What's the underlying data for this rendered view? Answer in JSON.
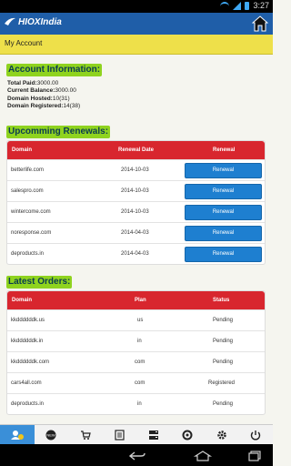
{
  "status_bar": {
    "left": "",
    "time": "3:27"
  },
  "app": {
    "brand": "HIOXIndia"
  },
  "subheader": {
    "title": "My Account"
  },
  "account": {
    "title": "Account Information:",
    "rows": [
      {
        "label": "Total Paid:",
        "value": "3000.00"
      },
      {
        "label": "Current Balance:",
        "value": "3000.00"
      },
      {
        "label": "Domain Hosted:",
        "value": "10(31)"
      },
      {
        "label": "Domain Registered:",
        "value": "14(38)"
      }
    ]
  },
  "renewals": {
    "title": "Upcomming Renewals:",
    "columns": [
      "Domain",
      "Renewal Date",
      "Renewal"
    ],
    "rows": [
      {
        "domain": "betterlife.com",
        "date": "2014-10-03",
        "action": "Renewal"
      },
      {
        "domain": "salespro.com",
        "date": "2014-10-03",
        "action": "Renewal"
      },
      {
        "domain": "wintercome.com",
        "date": "2014-10-03",
        "action": "Renewal"
      },
      {
        "domain": "noresponse.com",
        "date": "2014-04-03",
        "action": "Renewal"
      },
      {
        "domain": "deproducts.in",
        "date": "2014-04-03",
        "action": "Renewal"
      }
    ]
  },
  "orders": {
    "title": "Latest Orders:",
    "columns": [
      "Domain",
      "Plan",
      "Status"
    ],
    "rows": [
      {
        "domain": "kkddddddk.us",
        "plan": "us",
        "status": "Pending"
      },
      {
        "domain": "kkddddddk.in",
        "plan": "in",
        "status": "Pending"
      },
      {
        "domain": "kkddddddk.com",
        "plan": "com",
        "status": "Pending"
      },
      {
        "domain": "cars4all.com",
        "plan": "com",
        "status": "Registered"
      },
      {
        "domain": "deproducts.in",
        "plan": "in",
        "status": "Pending"
      }
    ]
  },
  "bottom_tabs": [
    {
      "icon": "account-icon",
      "active": true
    },
    {
      "icon": "new-badge-icon",
      "active": false
    },
    {
      "icon": "cart-icon",
      "active": false
    },
    {
      "icon": "invoice-icon",
      "active": false
    },
    {
      "icon": "server-icon",
      "active": false
    },
    {
      "icon": "support-icon",
      "active": false
    },
    {
      "icon": "settings-icon",
      "active": false
    },
    {
      "icon": "logout-icon",
      "active": false
    }
  ],
  "colors": {
    "appbar": "#1f5ea8",
    "subheader": "#eee04a",
    "section": "#8fd31f",
    "table_head": "#d8262e",
    "button": "#1e7fd0"
  }
}
